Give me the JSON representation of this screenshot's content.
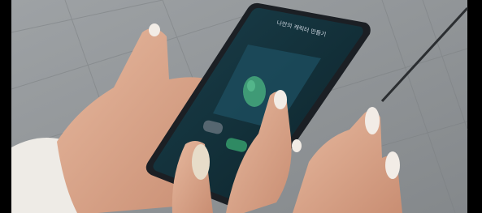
{
  "photo": {
    "subject": "hand-holding-smartphone",
    "screen_title": "나만의 캐릭터 만들기",
    "colors": {
      "pavement": "#8f9396",
      "phone_frame": "#1b1f24",
      "screen": "#12333d",
      "card": "#1a4556",
      "character": "#3f9a76",
      "skin": "#dba98f",
      "nail": "#f2ece6",
      "sleeve": "#efece8"
    }
  }
}
